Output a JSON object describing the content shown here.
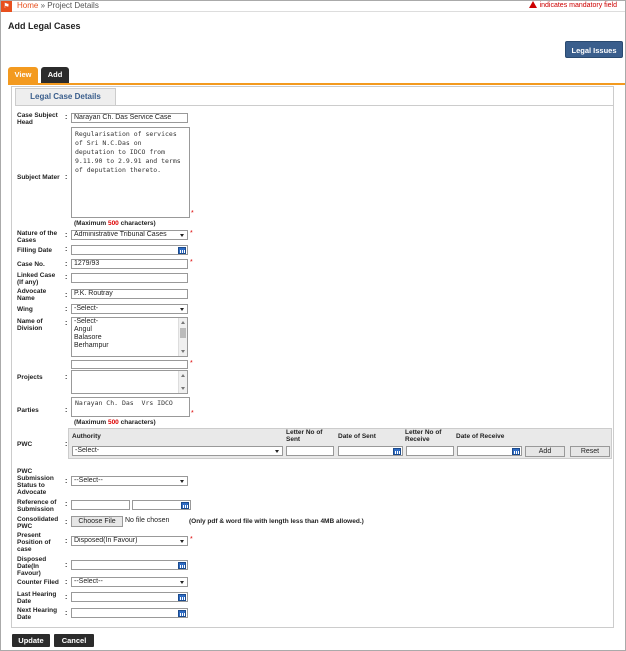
{
  "header": {
    "home_icon": "home-icon",
    "breadcrumb_home": "Home",
    "breadcrumb_sep": " » ",
    "breadcrumb_current": "Project Details",
    "mandatory_note": "indicates mandatory field"
  },
  "page_title": "Add Legal Cases",
  "legal_issues_button": "Legal Issues",
  "tabs": {
    "view": "View",
    "add": "Add"
  },
  "subtab": "Legal Case Details",
  "form": {
    "case_subject_head": {
      "label": "Case Subject Head",
      "value": "Narayan Ch. Das Service Case"
    },
    "subject_mater": {
      "label": "Subject Mater",
      "value": "Regularisation of services\nof Sri N.C.Das on\ndeputation to IDCO from\n9.11.90 to 2.9.91 and terms\nof deputation thereto.",
      "max_prefix": "(Maximum ",
      "max_num": "500",
      "max_suffix": " characters)"
    },
    "nature_of_cases": {
      "label": "Nature of the Cases",
      "value": "Administrative Tribunal Cases"
    },
    "filling_date": {
      "label": "Filling Date",
      "value": ""
    },
    "case_no": {
      "label": "Case No.",
      "value": "1279/93"
    },
    "linked_case": {
      "label": "Linked Case (If any)",
      "value": ""
    },
    "advocate_name": {
      "label": "Advocate Name",
      "value": "P.K. Routray"
    },
    "wing": {
      "label": "Wing",
      "value": "-Select-"
    },
    "name_of_division": {
      "label": "Name of Division",
      "options": [
        "-Select-",
        "Angul",
        "Balasore",
        "Berhampur"
      ]
    },
    "projects": {
      "label": "Projects",
      "value": ""
    },
    "parties": {
      "label": "Parties",
      "value": "Narayan Ch. Das  Vrs IDCO",
      "max_prefix": "(Maximum ",
      "max_num": "500",
      "max_suffix": " characters)"
    },
    "pwc": {
      "label": "PWC",
      "headers": {
        "authority": "Authority",
        "letter_sent": "Letter No of Sent",
        "date_sent": "Date of Sent",
        "letter_receive": "Letter No of Receive",
        "date_receive": "Date of Receive"
      },
      "authority_value": "-Select-",
      "add_button": "Add",
      "reset_button": "Reset"
    },
    "pwc_status": {
      "label": "PWC Submission Status to Advocate",
      "value": "--Select--"
    },
    "reference": {
      "label": "Reference of Submission"
    },
    "consolidated_pwc": {
      "label": "Consolidated PWC",
      "button": "Choose File",
      "file_text": "No file chosen",
      "note": "(Only pdf & word file with length less than 4MB allowed.)"
    },
    "present_position": {
      "label": "Present Position of case",
      "value": "Disposed(In Favour)"
    },
    "disposed_date": {
      "label": "Disposed Date(In Favour)"
    },
    "counter_filed": {
      "label": "Counter Filed",
      "value": "--Select--"
    },
    "last_hearing": {
      "label": "Last Hearing Date"
    },
    "next_hearing": {
      "label": "Next Hearing Date"
    }
  },
  "buttons": {
    "update": "Update",
    "cancel": "Cancel"
  },
  "colors": {
    "accent": "#f39a1f",
    "primary": "#3a5e8c",
    "required": "#d00"
  }
}
